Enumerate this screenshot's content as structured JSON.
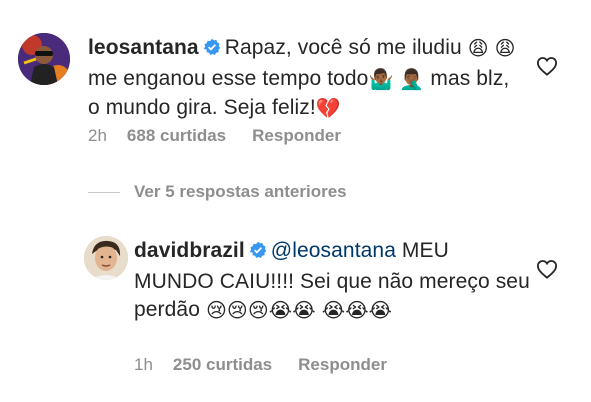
{
  "comments": [
    {
      "username": "leosantana",
      "text_parts": [
        {
          "type": "text",
          "value": "Rapaz, você só me iludiu "
        },
        {
          "type": "emoji",
          "value": "😩"
        },
        {
          "type": "text",
          "value": " "
        },
        {
          "type": "emoji",
          "value": "😩"
        },
        {
          "type": "text",
          "value": " me enganou esse tempo todo"
        },
        {
          "type": "emoji",
          "value": "🤷🏾‍♂️"
        },
        {
          "type": "text",
          "value": " "
        },
        {
          "type": "emoji",
          "value": "🤦🏾‍♂️"
        },
        {
          "type": "text",
          "value": " mas blz, o mundo gira. Seja feliz!"
        },
        {
          "type": "emoji",
          "value": "💔"
        }
      ],
      "time": "2h",
      "likes": "688 curtidas",
      "reply_label": "Responder"
    },
    {
      "username": "davidbrazil",
      "mention": "@leosantana",
      "text_parts": [
        {
          "type": "text",
          "value": " MEU MUNDO CAIU!!!! Sei que não mereço seu perdão "
        },
        {
          "type": "emoji",
          "value": "😢"
        },
        {
          "type": "emoji",
          "value": "😢"
        },
        {
          "type": "emoji",
          "value": "😢"
        },
        {
          "type": "emoji",
          "value": "😭"
        },
        {
          "type": "emoji",
          "value": "😭"
        },
        {
          "type": "text",
          "value": " "
        },
        {
          "type": "emoji",
          "value": "😭"
        },
        {
          "type": "emoji",
          "value": "😭"
        },
        {
          "type": "emoji",
          "value": "😭"
        }
      ],
      "time": "1h",
      "likes": "250 curtidas",
      "reply_label": "Responder"
    }
  ],
  "view_replies_label": "Ver 5 respostas anteriores",
  "colors": {
    "verified": "#3897f0",
    "mention": "#00376b",
    "meta": "#8e8e8e"
  },
  "icons": [
    "heart-icon",
    "verified-badge-icon"
  ]
}
